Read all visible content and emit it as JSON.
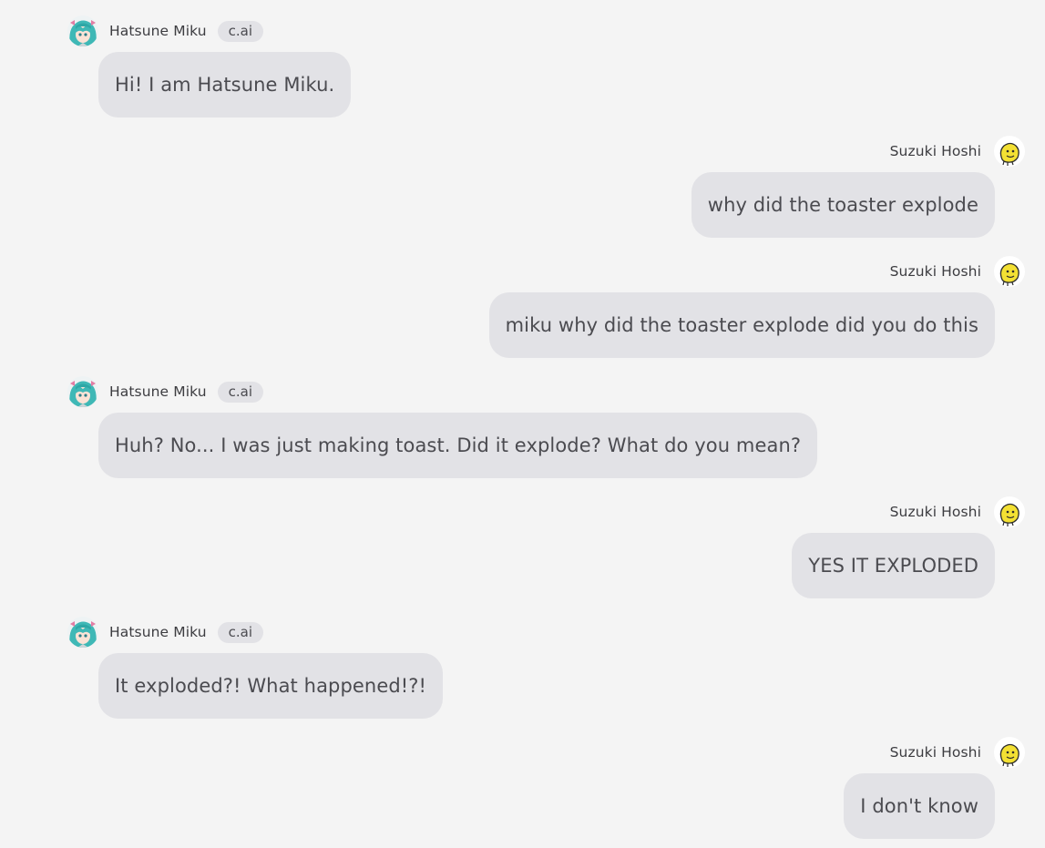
{
  "bot": {
    "name": "Hatsune Miku",
    "badge": "c.ai"
  },
  "user": {
    "name": "Suzuki Hoshi"
  },
  "messages": [
    {
      "sender": "bot",
      "text": "Hi! I am Hatsune Miku."
    },
    {
      "sender": "user",
      "text": "why did the toaster explode"
    },
    {
      "sender": "user",
      "text": "miku why did the toaster explode did you do this"
    },
    {
      "sender": "bot",
      "text": "Huh? No... I was just making toast. Did it explode? What do you mean?"
    },
    {
      "sender": "user",
      "text": "YES IT EXPLODED"
    },
    {
      "sender": "bot",
      "text": "It exploded?! What happened!?!"
    },
    {
      "sender": "user",
      "text": "I don't know"
    }
  ],
  "icons": {
    "bot_avatar": "miku-avatar-icon",
    "user_avatar": "yellow-blob-avatar-icon"
  },
  "colors": {
    "background": "#f4f4f4",
    "bubble": "#e2e2e6",
    "badge": "#e2e2e6",
    "text": "#4b4b50"
  }
}
